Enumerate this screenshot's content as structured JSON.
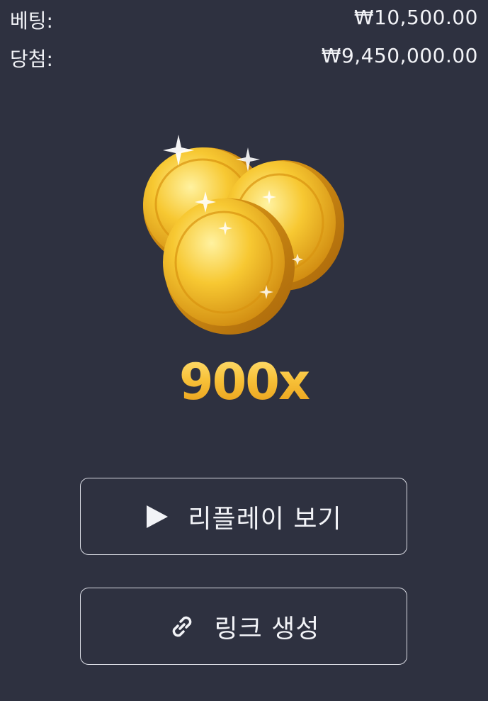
{
  "summary": {
    "bet_label": "베팅:",
    "bet_value": "₩10,500.00",
    "win_label": "당첨:",
    "win_value": "₩9,450,000.00"
  },
  "result": {
    "multiplier": "900x",
    "image_icon": "gold-coins-icon"
  },
  "actions": {
    "replay_label": "리플레이 보기",
    "replay_icon": "play-icon",
    "link_label": "링크 생성",
    "link_icon": "link-chain-icon"
  },
  "colors": {
    "background": "#2e3140",
    "gold": "#f6b52a",
    "button_border": "#d9dbe3"
  }
}
